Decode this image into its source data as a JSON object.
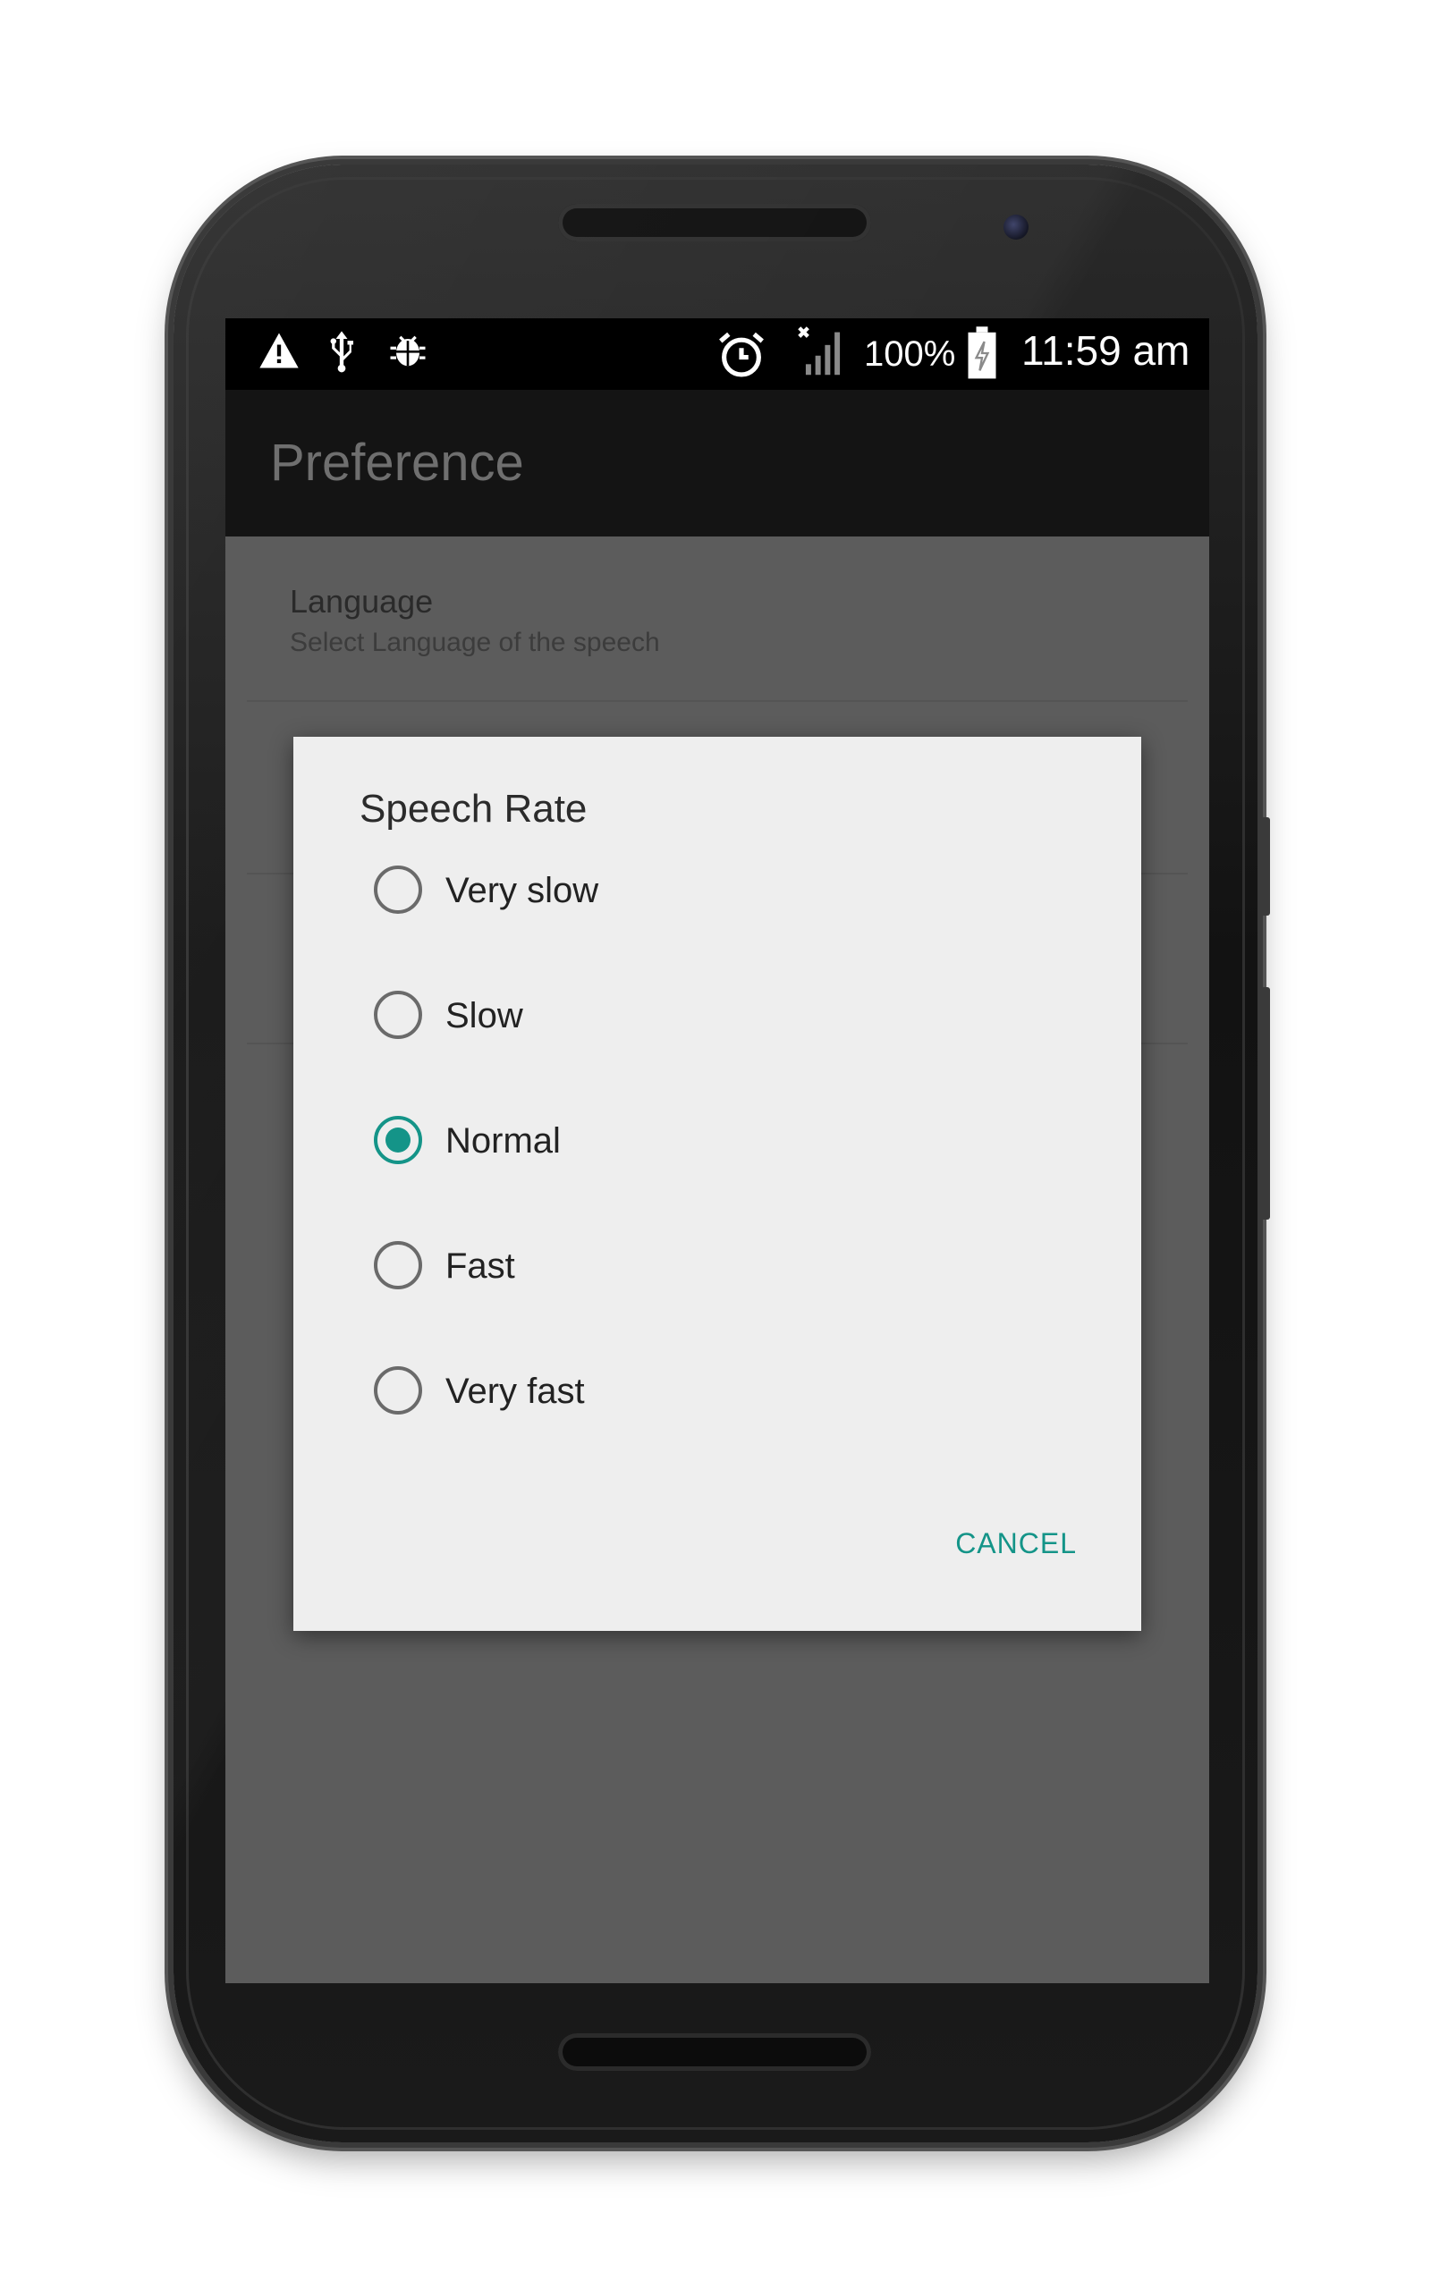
{
  "status_bar": {
    "icons_left": [
      "warning-icon",
      "usb-icon",
      "android-debug-icon"
    ],
    "icons_right": [
      "alarm-icon",
      "signal-icon",
      "battery-charging-icon"
    ],
    "battery_percent": "100%",
    "time": "11:59 am"
  },
  "app_bar": {
    "title": "Preference"
  },
  "preferences": {
    "items": [
      {
        "title": "Language",
        "summary": "Select Language of the speech"
      }
    ]
  },
  "dialog": {
    "title": "Speech Rate",
    "options": [
      {
        "label": "Very slow",
        "checked": false
      },
      {
        "label": "Slow",
        "checked": false
      },
      {
        "label": "Normal",
        "checked": true
      },
      {
        "label": "Fast",
        "checked": false
      },
      {
        "label": "Very fast",
        "checked": false
      }
    ],
    "cancel_label": "CANCEL"
  },
  "colors": {
    "accent": "#149488",
    "dialog_bg": "#eeeeee",
    "screen_dim": "#5c5c5c",
    "app_bar": "#141414"
  }
}
